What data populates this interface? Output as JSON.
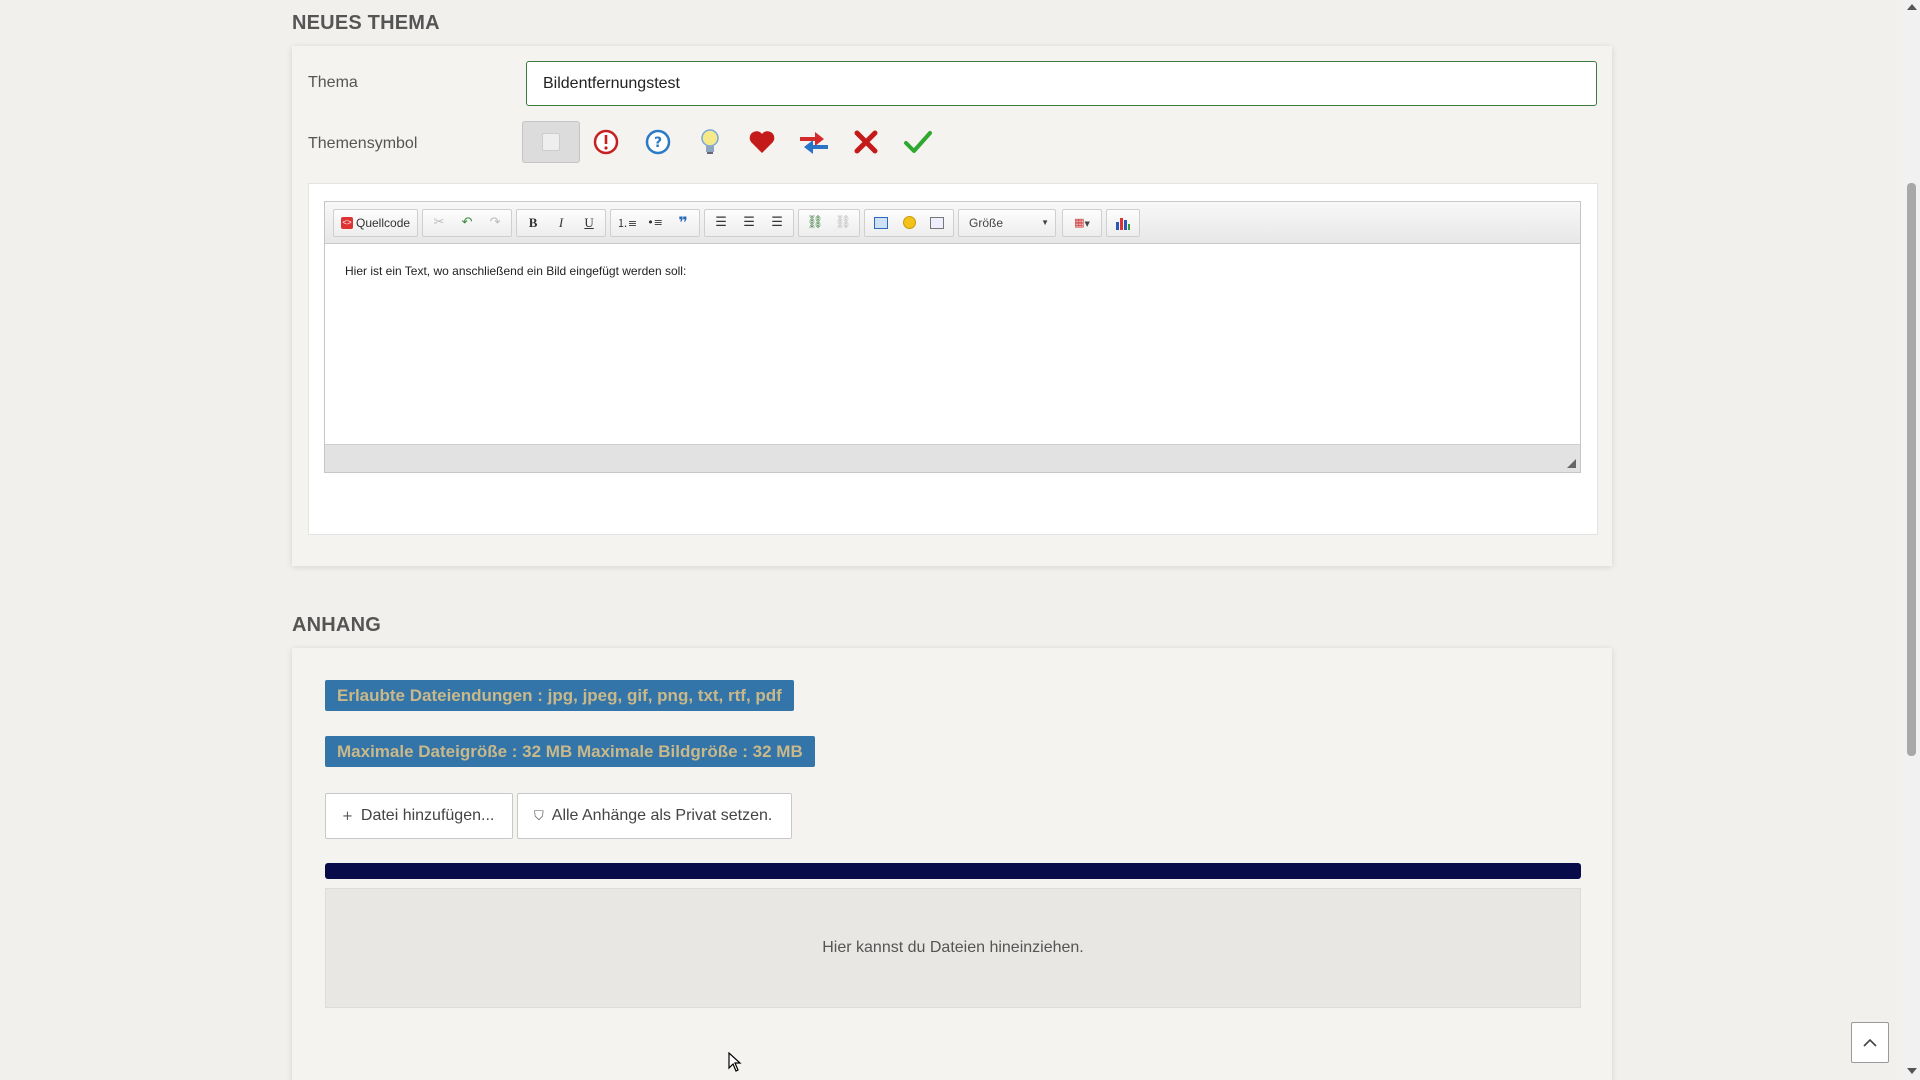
{
  "new_topic": {
    "section_title": "NEUES THEMA",
    "topic_label": "Thema",
    "topic_value": "Bildentfernungstest",
    "symbol_label": "Themensymbol",
    "symbols": [
      "none",
      "exclamation-icon",
      "question-icon",
      "lightbulb-icon",
      "heart-icon",
      "arrows-icon",
      "cross-icon",
      "checkmark-icon"
    ],
    "selected_symbol": "none"
  },
  "editor": {
    "source_label": "Quellcode",
    "size_label": "Größe",
    "content": "Hier ist ein Text, wo anschließend ein Bild eingefügt werden soll:"
  },
  "attachment": {
    "section_title": "ANHANG",
    "allowed_extensions": "Erlaubte Dateiendungen : jpg, jpeg, gif, png, txt, rtf, pdf",
    "max_size": "Maximale Dateigröße : 32 MB Maximale Bildgröße : 32 MB",
    "add_file_label": "Datei hinzufügen...",
    "set_private_label": "Alle Anhänge als Privat setzen.",
    "dropzone_text": "Hier kannst du Dateien hineinziehen."
  },
  "colors": {
    "badge_bg": "#3375a8",
    "badge_text": "#c9b88a",
    "progress": "#070b4a",
    "input_border": "#3c7a3c"
  }
}
